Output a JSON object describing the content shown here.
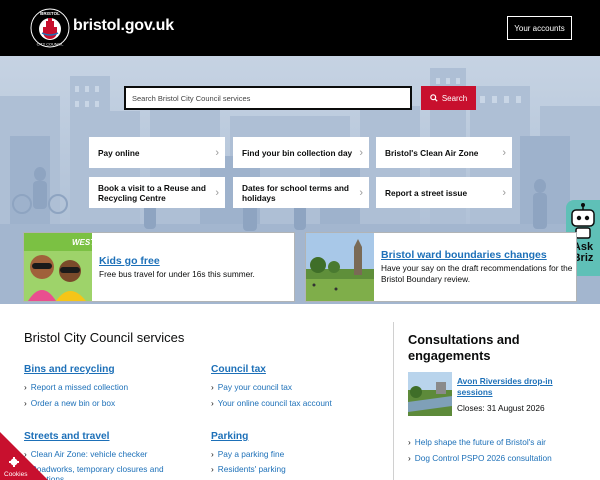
{
  "header": {
    "logo_text": "bristol.gov.uk",
    "crest_lettering": "BRISTOL CITY COUNCIL",
    "accounts_button": "Your accounts"
  },
  "search": {
    "placeholder": "Search Bristol City Council services",
    "button_label": "Search"
  },
  "quick_links": [
    "Pay online",
    "Find your bin collection day",
    "Bristol's Clean Air Zone",
    "Book a visit to a Reuse and Recycling Centre",
    "Dates for school terms and holidays",
    "Report a street issue"
  ],
  "ask_briz": {
    "line1": "Ask",
    "line2": "Briz"
  },
  "promos": [
    {
      "image_text": "WEST",
      "title": "Kids go free",
      "text": "Free bus travel for under 16s this summer."
    },
    {
      "title": "Bristol ward boundaries changes",
      "text": "Have your say on the draft recommendations for the Bristol Boundary review."
    }
  ],
  "services": {
    "title": "Bristol City Council services",
    "categories": [
      {
        "title": "Bins and recycling",
        "links": [
          "Report a missed collection",
          "Order a new bin or box"
        ]
      },
      {
        "title": "Council tax",
        "links": [
          "Pay your council tax",
          "Your online council tax account"
        ]
      },
      {
        "title": "Streets and travel",
        "links": [
          "Clean Air Zone: vehicle checker",
          "Roadworks, temporary closures and restrictions"
        ]
      },
      {
        "title": "Parking",
        "links": [
          "Pay a parking fine",
          "Residents' parking"
        ]
      }
    ]
  },
  "consultations": {
    "title": "Consultations and engagements",
    "featured": {
      "title": "Avon Riversides drop-in sessions",
      "closes": "Closes: 31 August 2026"
    },
    "links": [
      "Help shape the future of Bristol's air",
      "Dog Control PSPO 2026 consultation"
    ]
  },
  "cookies": {
    "label": "Cookies"
  },
  "colors": {
    "header_bg": "#000000",
    "search_button": "#c8102e",
    "link": "#1d70b8",
    "ask_briz": "#5fc0b7",
    "cookies": "#c8102e"
  }
}
